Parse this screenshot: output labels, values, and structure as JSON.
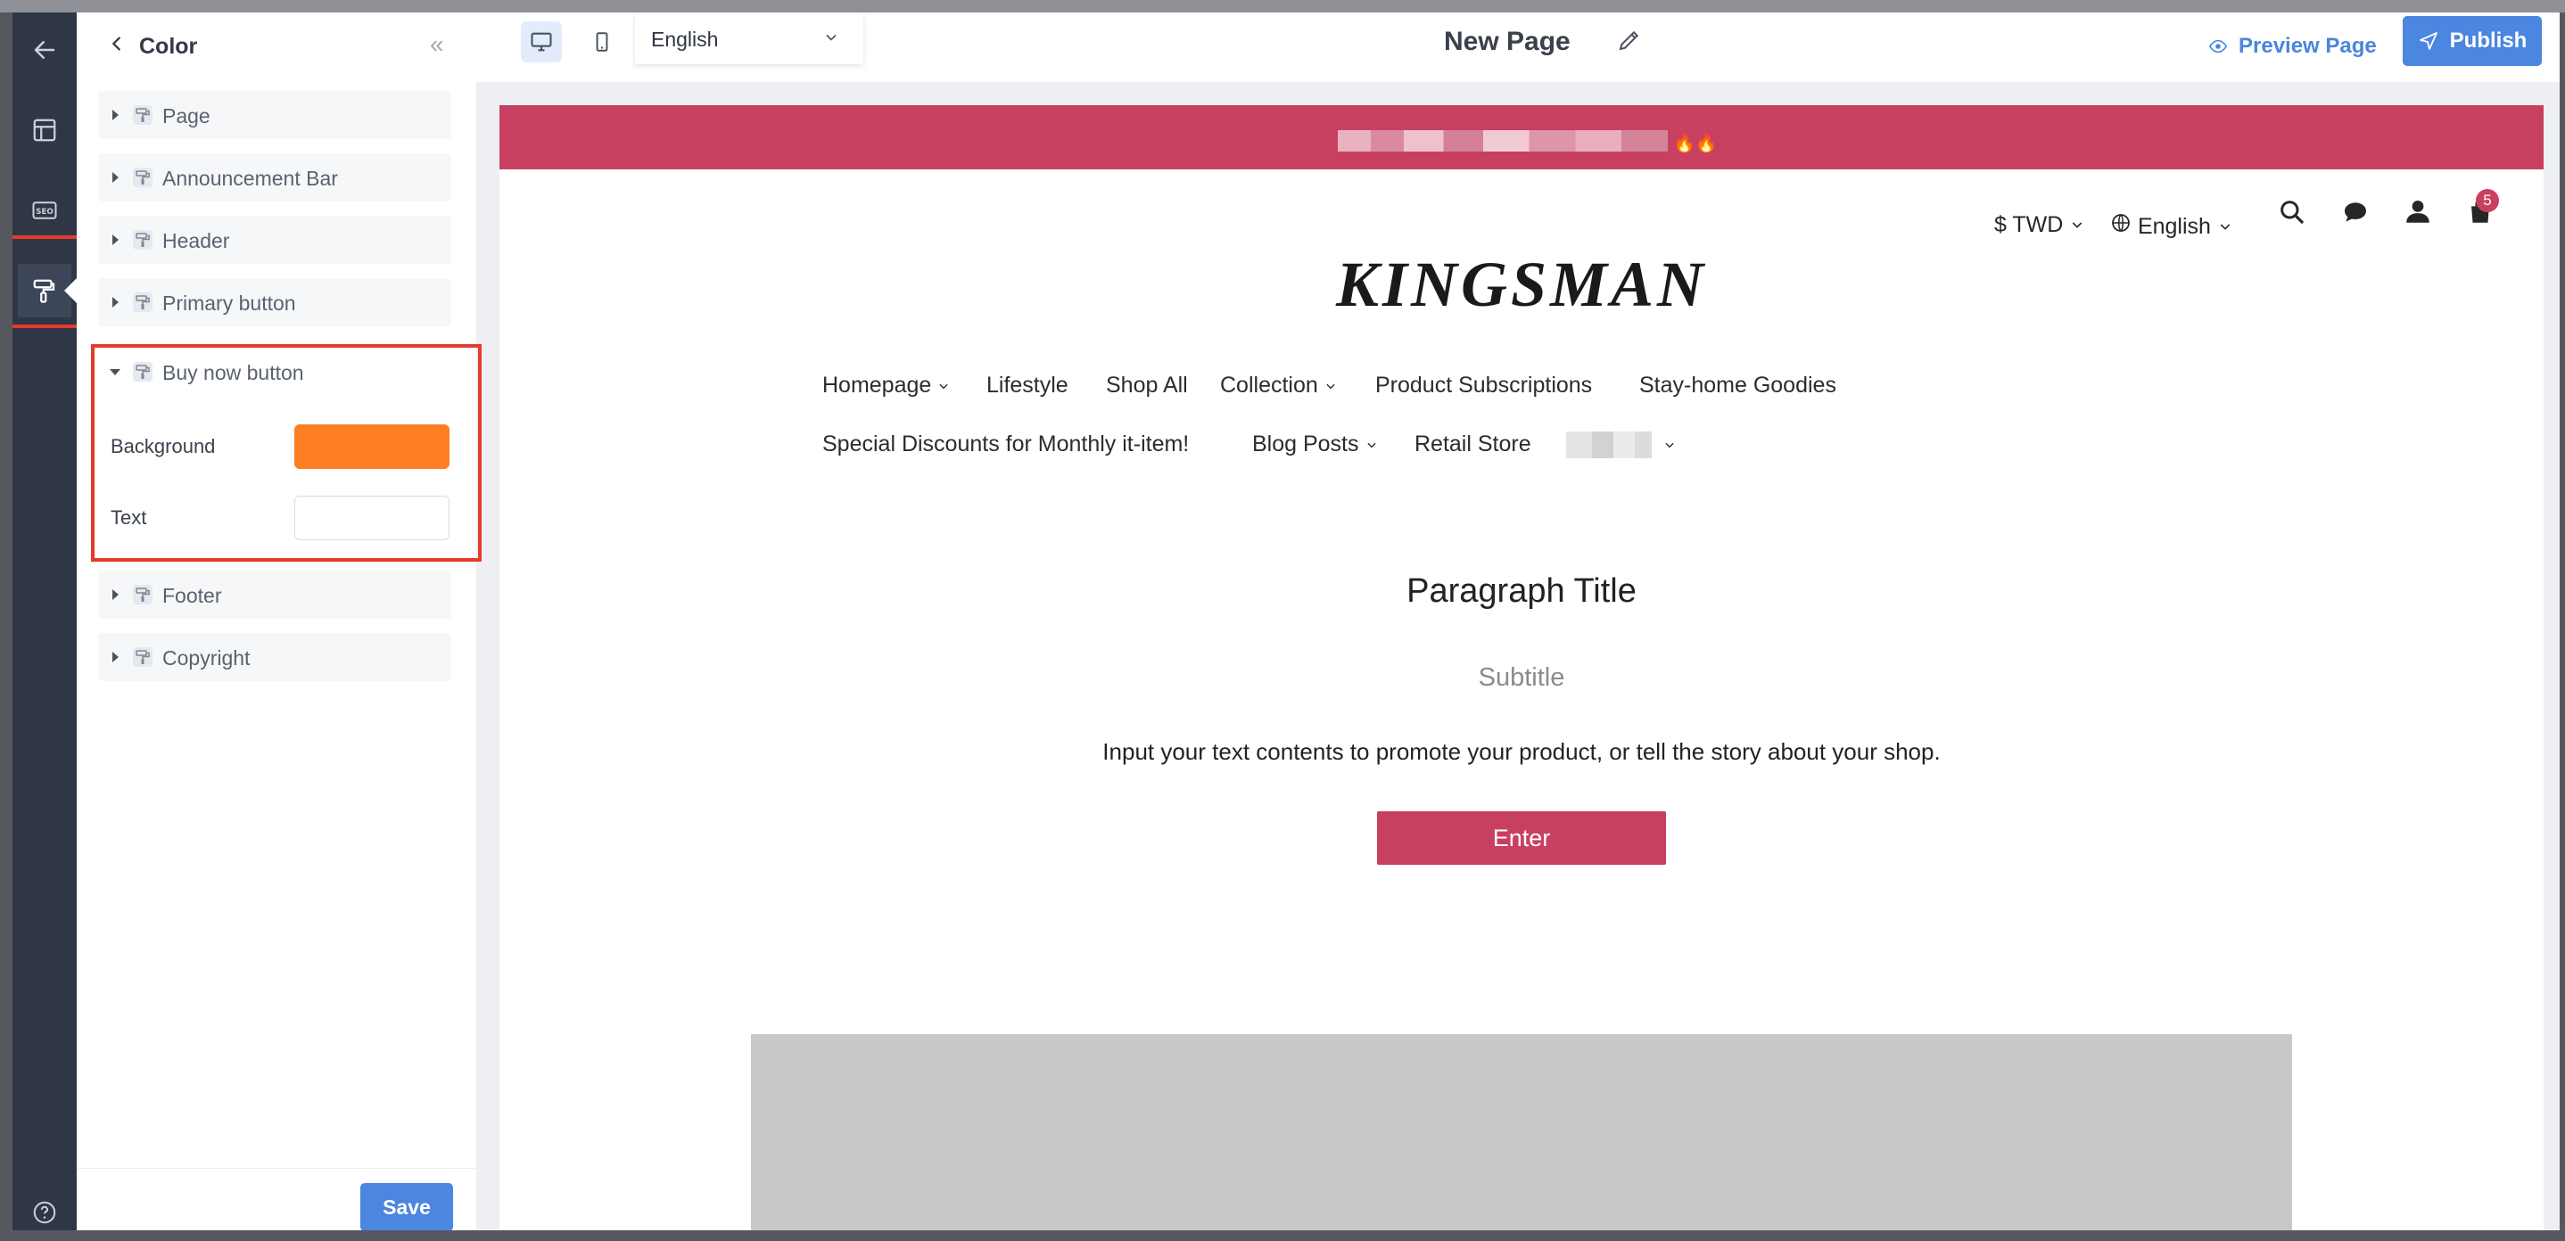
{
  "panel": {
    "title": "Color",
    "items": [
      {
        "label": "Page"
      },
      {
        "label": "Announcement Bar"
      },
      {
        "label": "Header"
      },
      {
        "label": "Primary button"
      },
      {
        "label": "Buy now button",
        "expanded": true
      },
      {
        "label": "Footer"
      },
      {
        "label": "Copyright"
      }
    ],
    "buy_now": {
      "background_label": "Background",
      "text_label": "Text",
      "background_color": "#fd7e23",
      "text_color": "#ffffff"
    },
    "save_label": "Save"
  },
  "topbar": {
    "language": "English",
    "page_title": "New Page",
    "preview_label": "Preview Page",
    "publish_label": "Publish"
  },
  "store": {
    "currency": "$ TWD",
    "language": "English",
    "cart_count": "5",
    "logo": "KINGSMAN",
    "nav_row1": [
      "Homepage",
      "Lifestyle",
      "Shop All",
      "Collection",
      "Product Subscriptions",
      "Stay-home Goodies"
    ],
    "nav_row2": [
      "Special Discounts for Monthly it-item!",
      "Blog Posts",
      "Retail Store"
    ],
    "paragraph_title": "Paragraph Title",
    "subtitle": "Subtitle",
    "body": "Input your text contents to promote your product, or tell the story about your shop.",
    "button": "Enter"
  },
  "colors": {
    "accent": "#4b86e0",
    "brand": "#c84060",
    "highlight": "#e53a2c"
  }
}
